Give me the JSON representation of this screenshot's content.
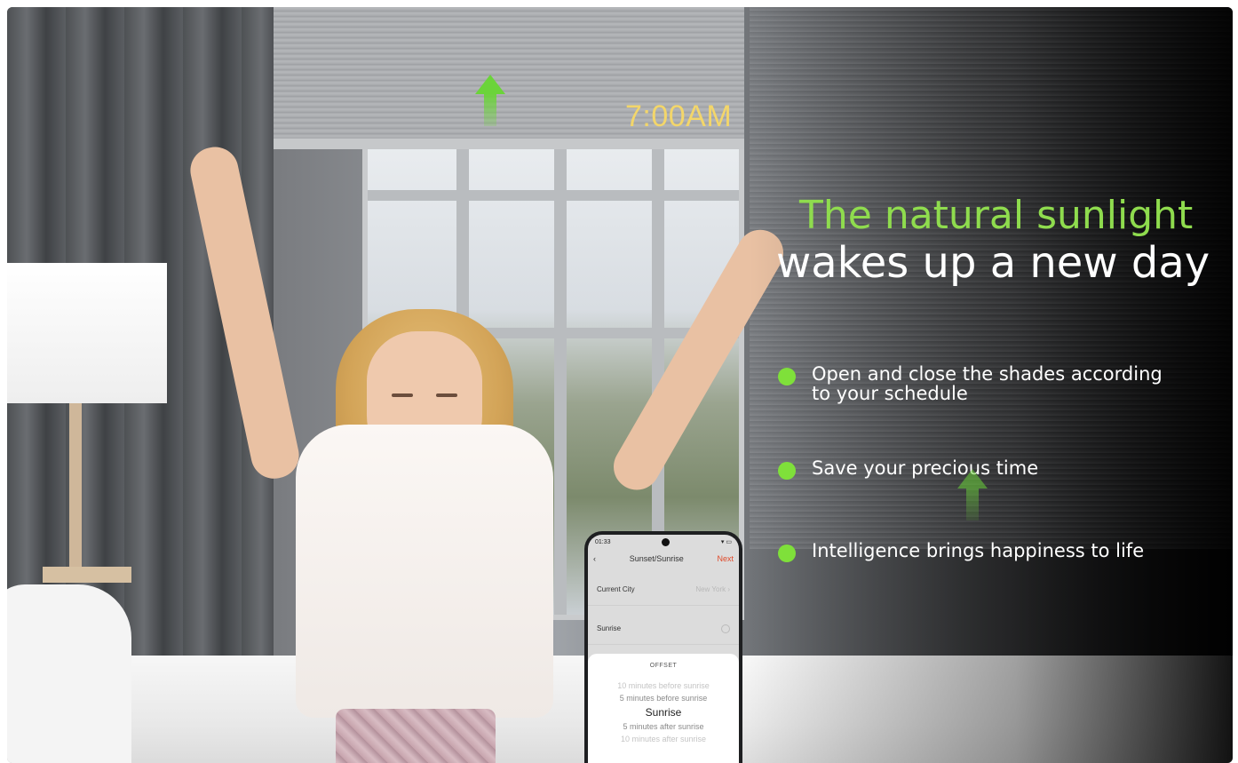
{
  "scene": {
    "time_label": "7:00AM"
  },
  "headline": {
    "line1": "The natural sunlight",
    "line2": "wakes up a new day"
  },
  "features": [
    {
      "text": "Open and close the shades according\nto your schedule"
    },
    {
      "text": "Save your precious time"
    },
    {
      "text": "Intelligence brings happiness to life"
    }
  ],
  "phone": {
    "status_time": "01:33",
    "title": "Sunset/Sunrise",
    "back_icon": "chevron-left-icon",
    "next_label": "Next",
    "rows": [
      {
        "label": "Current City",
        "value": "New York"
      },
      {
        "label": "Sunrise",
        "value": ""
      }
    ],
    "offset": {
      "title": "OFFSET",
      "options": [
        "10 minutes before sunrise",
        "5 minutes before sunrise",
        "Sunrise",
        "5 minutes after sunrise",
        "10 minutes after sunrise"
      ]
    }
  },
  "colors": {
    "accent_green": "#8fdc4e",
    "bullet_green": "#7fe03a",
    "time_yellow": "#f3d66a",
    "next_red": "#e04a2a"
  }
}
